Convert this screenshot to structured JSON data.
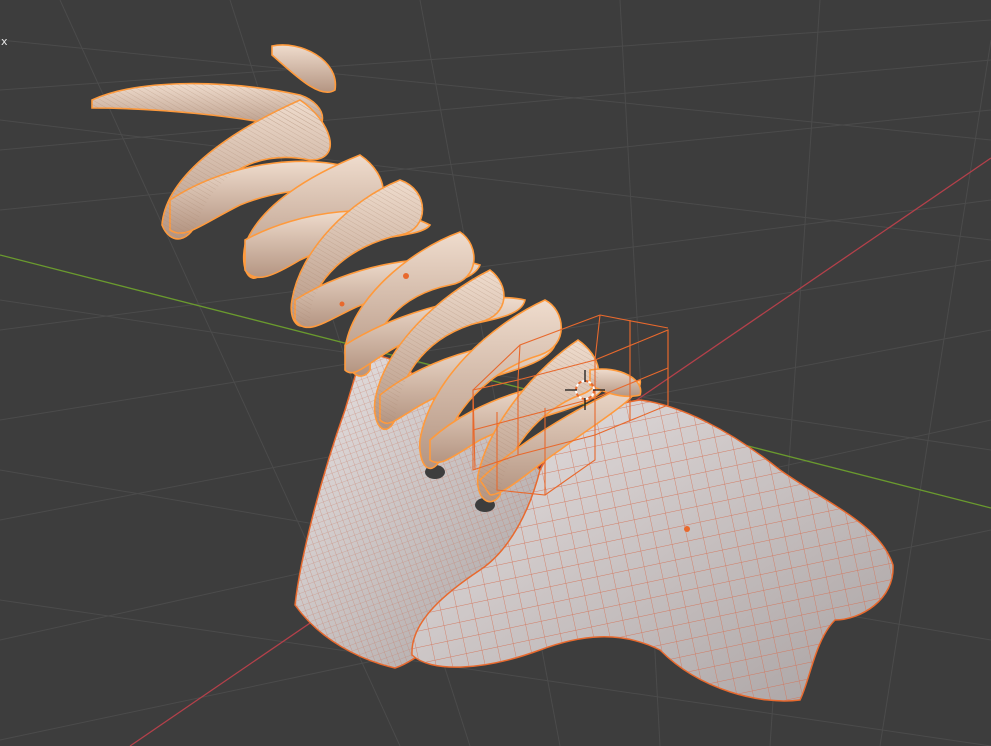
{
  "viewport": {
    "corner_label": "x",
    "colors": {
      "background": "#3d3d3d",
      "grid": "#4b4b4b",
      "x_axis": "#b3404a",
      "y_axis": "#6a9a2e",
      "selection": "#e8692d",
      "active_outline": "#ff9a3c",
      "laces": "#d9c3b5",
      "mesh": "#d6d0cf",
      "wire": "#d4745a"
    },
    "objects": [
      "shoe-laces",
      "shoe-tongue",
      "shoe-body",
      "lattice-cage",
      "3d-cursor"
    ]
  }
}
